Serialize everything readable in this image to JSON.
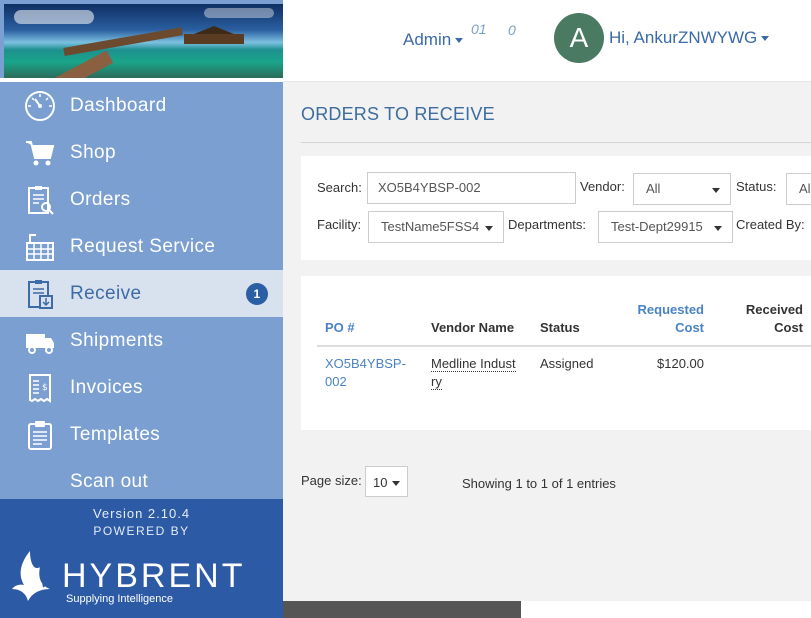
{
  "header": {
    "admin_label": "Admin",
    "count_one": "01",
    "count_two": "0",
    "avatar_letter": "A",
    "greeting": "Hi, AnkurZNWYWG"
  },
  "sidebar": {
    "items": [
      {
        "label": "Dashboard",
        "icon": "dashboard-icon"
      },
      {
        "label": "Shop",
        "icon": "cart-icon"
      },
      {
        "label": "Orders",
        "icon": "orders-icon"
      },
      {
        "label": "Request Service",
        "icon": "request-service-icon"
      },
      {
        "label": "Receive",
        "icon": "receive-icon",
        "badge": "1",
        "active": true
      },
      {
        "label": "Shipments",
        "icon": "truck-icon"
      },
      {
        "label": "Invoices",
        "icon": "invoice-icon"
      },
      {
        "label": "Templates",
        "icon": "clipboard-icon"
      },
      {
        "label": "Scan out"
      }
    ],
    "version": "Version 2.10.4",
    "powered_by": "POWERED BY",
    "brand_name": "HYBRENT",
    "brand_tagline": "Supplying Intelligence"
  },
  "main": {
    "title": "ORDERS TO RECEIVE",
    "filters": {
      "search_label": "Search:",
      "search_value": "XO5B4YBSP-002",
      "vendor_label": "Vendor:",
      "vendor_value": "All",
      "status_label": "Status:",
      "status_value": "All",
      "facility_label": "Facility:",
      "facility_value": "TestName5FSS4",
      "departments_label": "Departments:",
      "departments_value": "Test-Dept29915",
      "created_by_label": "Created By:"
    },
    "table": {
      "columns": {
        "po": "PO #",
        "vendor": "Vendor Name",
        "status": "Status",
        "requested_line1": "Requested",
        "requested_line2": "Cost",
        "received_line1": "Received",
        "received_line2": "Cost"
      },
      "rows": [
        {
          "po_line1": "XO5B4YBSP-",
          "po_line2": "002",
          "vendor_line1": "Medline Indust",
          "vendor_line2": "ry",
          "status": "Assigned",
          "requested_cost": "$120.00"
        }
      ]
    },
    "pagination": {
      "page_size_label": "Page size:",
      "page_size_value": "10",
      "showing": "Showing 1 to 1 of 1 entries"
    }
  },
  "colors": {
    "sidebar_bg": "#7a9fd0",
    "sidebar_active_bg": "#d7e2ee",
    "footer_bg": "#2d5aa5",
    "accent": "#3b6aa8",
    "avatar_bg": "#4a7a62",
    "badge_bg": "#2b5fa3"
  }
}
